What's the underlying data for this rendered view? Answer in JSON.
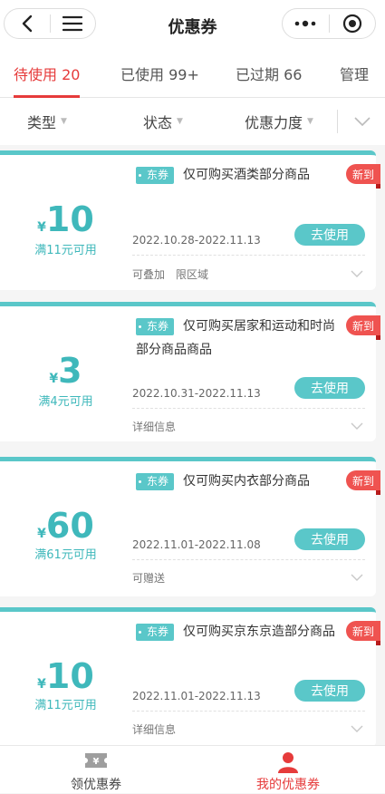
{
  "header": {
    "title": "优惠券",
    "colors": {
      "accent": "#e63b3b",
      "teal": "#5ac7c9",
      "badge": "#ef5350"
    }
  },
  "tabs": [
    {
      "label": "待使用 20",
      "active": true
    },
    {
      "label": "已使用 99+",
      "active": false
    },
    {
      "label": "已过期 66",
      "active": false
    },
    {
      "label": "管理",
      "active": false
    }
  ],
  "filters": [
    {
      "label": "类型"
    },
    {
      "label": "状态"
    },
    {
      "label": "优惠力度"
    }
  ],
  "coupons": [
    {
      "currency": "¥",
      "amount": "10",
      "condition": "满11元可用",
      "tag": "东券",
      "description": "仅可购买酒类部分商品",
      "badge": "新到",
      "date": "2022.10.28-2022.11.13",
      "button": "去使用",
      "extras": [
        "可叠加",
        "限区域"
      ]
    },
    {
      "currency": "¥",
      "amount": "3",
      "condition": "满4元可用",
      "tag": "东券",
      "description": "仅可购买居家和运动和时尚部分商品商品",
      "badge": "新到",
      "date": "2022.10.31-2022.11.13",
      "button": "去使用",
      "extras": [
        "详细信息"
      ]
    },
    {
      "currency": "¥",
      "amount": "60",
      "condition": "满61元可用",
      "tag": "东券",
      "description": "仅可购买内衣部分商品",
      "badge": "新到",
      "date": "2022.11.01-2022.11.08",
      "button": "去使用",
      "extras": [
        "可赠送"
      ]
    },
    {
      "currency": "¥",
      "amount": "10",
      "condition": "满11元可用",
      "tag": "东券",
      "description": "仅可购买京东京造部分商品",
      "badge": "新到",
      "date": "2022.11.01-2022.11.13",
      "button": "去使用",
      "extras": [
        "详细信息"
      ]
    }
  ],
  "bottom_tabs": [
    {
      "label": "领优惠券",
      "icon": "ticket-icon",
      "active": false
    },
    {
      "label": "我的优惠券",
      "icon": "user-icon",
      "active": true
    }
  ]
}
